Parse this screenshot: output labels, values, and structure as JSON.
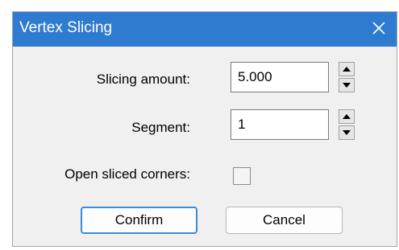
{
  "window": {
    "title": "Vertex Slicing",
    "close_icon": "close-icon"
  },
  "form": {
    "slicing_amount": {
      "label": "Slicing amount:",
      "value": "5.000",
      "spin_up_icon": "triangle-up-icon",
      "spin_down_icon": "triangle-down-icon"
    },
    "segment": {
      "label": "Segment:",
      "value": "1",
      "spin_up_icon": "triangle-up-icon",
      "spin_down_icon": "triangle-down-icon"
    },
    "open_sliced_corners": {
      "label": "Open sliced corners:",
      "checked": false
    }
  },
  "buttons": {
    "confirm_label": "Confirm",
    "cancel_label": "Cancel"
  },
  "colors": {
    "titlebar": "#2f7bd0",
    "dialog_background": "#f0f0f0",
    "primary_button_border": "#3a8be0"
  }
}
